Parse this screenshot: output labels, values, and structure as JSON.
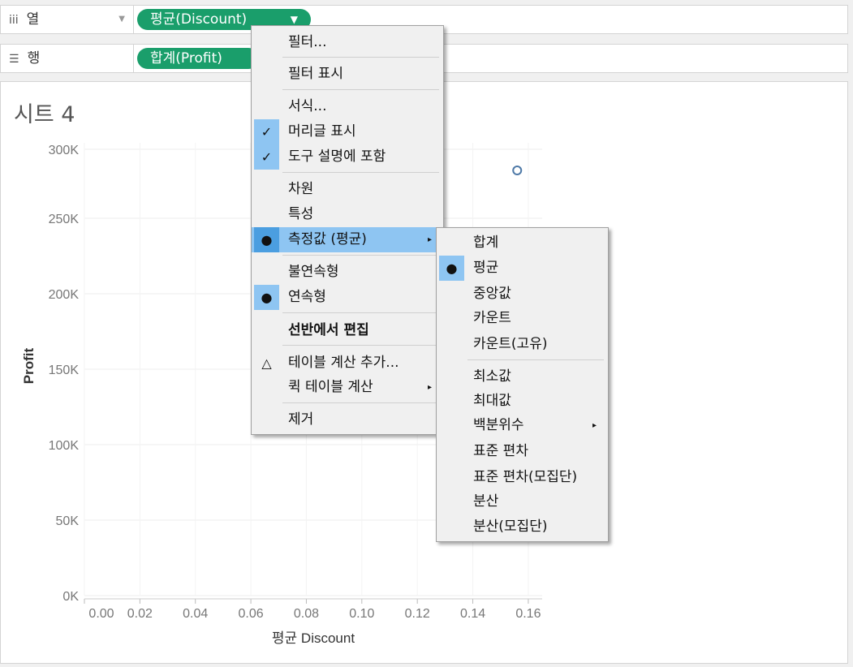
{
  "shelves": {
    "columns": {
      "icon": "iii",
      "label": "열",
      "pill": "평균(Discount)"
    },
    "rows": {
      "icon": "☰",
      "label": "행",
      "pill": "합계(Profit)"
    }
  },
  "sheet": {
    "title": "시트 4"
  },
  "chart_data": {
    "type": "scatter",
    "xlabel": "평균 Discount",
    "ylabel": "Profit",
    "x_ticks": [
      "0.00",
      "0.02",
      "0.04",
      "0.06",
      "0.08",
      "0.10",
      "0.12",
      "0.14",
      "0.16"
    ],
    "y_ticks": [
      "300K",
      "250K",
      "200K",
      "150K",
      "100K",
      "50K",
      "0K"
    ],
    "xlim": [
      0,
      0.165
    ],
    "ylim": [
      0,
      300000
    ],
    "points": [
      {
        "x": 0.156,
        "y": 286000
      }
    ],
    "marker_color": "#4e79a7",
    "grid": true
  },
  "context_menu": {
    "items": [
      {
        "label": "필터..."
      },
      {
        "label": "필터 표시"
      },
      {
        "label": "서식..."
      },
      {
        "label": "머리글 표시",
        "mark": "✓"
      },
      {
        "label": "도구 설명에 포함",
        "mark": "✓"
      },
      {
        "label": "차원"
      },
      {
        "label": "특성"
      },
      {
        "label": "측정값 (평균)",
        "mark": "●",
        "submenu_arrow": "▸"
      },
      {
        "label": "불연속형"
      },
      {
        "label": "연속형",
        "mark": "●"
      },
      {
        "label": "선반에서 편집"
      },
      {
        "label": "테이블 계산 추가...",
        "mark": "△"
      },
      {
        "label": "퀵 테이블 계산",
        "submenu_arrow": "▸"
      },
      {
        "label": "제거"
      }
    ]
  },
  "sub_menu": {
    "items": [
      {
        "label": "합계"
      },
      {
        "label": "평균",
        "mark": "●"
      },
      {
        "label": "중앙값"
      },
      {
        "label": "카운트"
      },
      {
        "label": "카운트(고유)"
      },
      {
        "label": "최소값"
      },
      {
        "label": "최대값"
      },
      {
        "label": "백분위수",
        "submenu_arrow": "▸"
      },
      {
        "label": "표준 편차"
      },
      {
        "label": "표준 편차(모집단)"
      },
      {
        "label": "분산"
      },
      {
        "label": "분산(모집단)"
      }
    ]
  },
  "colors": {
    "pill": "#1a9e6b",
    "highlight": "#8ec5f2",
    "accent": "#4b9ee0"
  }
}
